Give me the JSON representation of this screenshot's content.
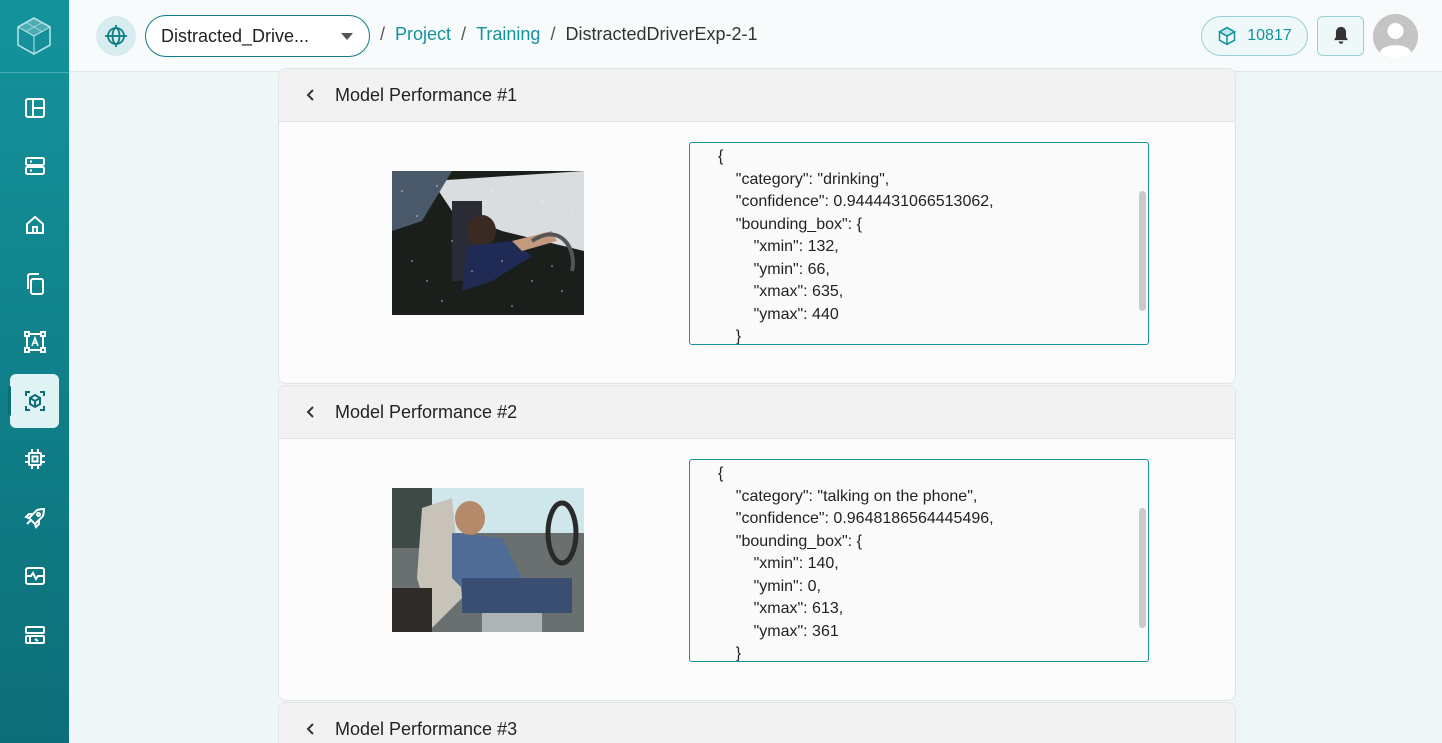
{
  "header": {
    "project_name": "Distracted_Drive...",
    "breadcrumbs": [
      "Project",
      "Training",
      "DistractedDriverExp-2-1"
    ],
    "credits": "10817"
  },
  "sidebar": {
    "items": [
      "layout-icon",
      "server-icon",
      "home-icon",
      "copy-icon",
      "annotate-icon",
      "model-icon",
      "chip-icon",
      "rocket-icon",
      "monitor-icon",
      "dashboard-icon"
    ],
    "active": "model-icon"
  },
  "cards": [
    {
      "title": "Model Performance #1",
      "json": "{\n    \"category\": \"drinking\",\n    \"confidence\": 0.9444431066513062,\n    \"bounding_box\": {\n        \"xmin\": 132,\n        \"ymin\": 66,\n        \"xmax\": 635,\n        \"ymax\": 440\n    }"
    },
    {
      "title": "Model Performance #2",
      "json": "{\n    \"category\": \"talking on the phone\",\n    \"confidence\": 0.9648186564445496,\n    \"bounding_box\": {\n        \"xmin\": 140,\n        \"ymin\": 0,\n        \"xmax\": 613,\n        \"ymax\": 361\n    }"
    },
    {
      "title": "Model Performance #3"
    }
  ],
  "colors": {
    "accent": "#14939c",
    "sidebar": "#0f7d86"
  }
}
